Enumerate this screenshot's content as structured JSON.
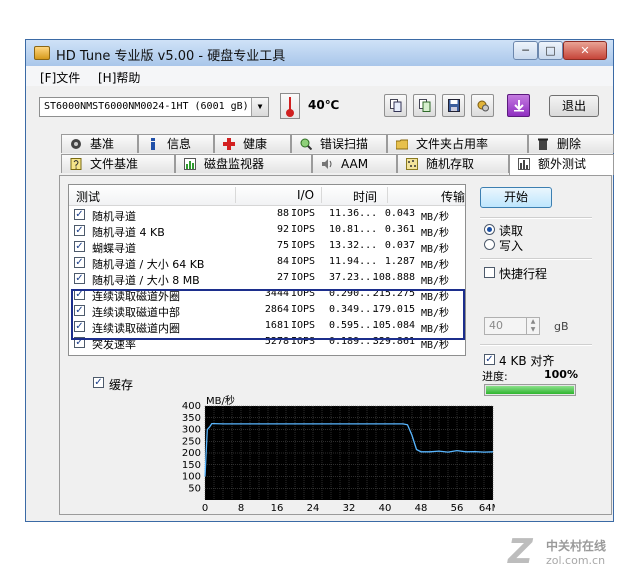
{
  "window": {
    "title": "HD Tune 专业版 v5.00 - 硬盘专业工具",
    "min": "─",
    "max": "□",
    "close": "✕"
  },
  "menu": [
    "[F]文件",
    "[H]帮助"
  ],
  "toolbar": {
    "drive": "ST6000NMST6000NM0024-1HT (6001 gB)",
    "temperature": "40℃",
    "exit_label": "退出",
    "buttons": [
      "copy-icon",
      "copy-all-icon",
      "save-icon",
      "options-icon",
      "download-icon"
    ]
  },
  "tabs_row1": [
    {
      "label": "基准",
      "icon": "benchmark-icon"
    },
    {
      "label": "信息",
      "icon": "info-icon"
    },
    {
      "label": "健康",
      "icon": "health-icon"
    },
    {
      "label": "错误扫描",
      "icon": "error-scan-icon"
    },
    {
      "label": "文件夹占用率",
      "icon": "folder-icon"
    },
    {
      "label": "删除",
      "icon": "erase-icon"
    }
  ],
  "tabs_row2": [
    {
      "label": "文件基准",
      "icon": "file-benchmark-icon"
    },
    {
      "label": "磁盘监视器",
      "icon": "disk-monitor-icon"
    },
    {
      "label": "AAM",
      "icon": "aam-icon"
    },
    {
      "label": "随机存取",
      "icon": "random-access-icon"
    },
    {
      "label": "额外测试",
      "icon": "extra-tests-icon"
    }
  ],
  "results": {
    "headers": {
      "test": "测试",
      "io": "I/O",
      "time": "时间",
      "rate": "传输"
    },
    "rows": [
      {
        "name": "随机寻道",
        "iops": "88",
        "iops_unit": "IOPS",
        "time": "11.36...",
        "rate": "0.043",
        "unit": "MB/秒"
      },
      {
        "name": "随机寻道 4 KB",
        "iops": "92",
        "iops_unit": "IOPS",
        "time": "10.81...",
        "rate": "0.361",
        "unit": "MB/秒"
      },
      {
        "name": "蝴蝶寻道",
        "iops": "75",
        "iops_unit": "IOPS",
        "time": "13.32...",
        "rate": "0.037",
        "unit": "MB/秒"
      },
      {
        "name": "随机寻道 / 大小 64 KB",
        "iops": "84",
        "iops_unit": "IOPS",
        "time": "11.94...",
        "rate": "1.287",
        "unit": "MB/秒"
      },
      {
        "name": "随机寻道 / 大小 8 MB",
        "iops": "27",
        "iops_unit": "IOPS",
        "time": "37.23...",
        "rate": "108.888",
        "unit": "MB/秒"
      },
      {
        "name": "连续读取磁道外圈",
        "iops": "3444",
        "iops_unit": "IOPS",
        "time": "0.290...",
        "rate": "215.275",
        "unit": "MB/秒"
      },
      {
        "name": "连续读取磁道中部",
        "iops": "2864",
        "iops_unit": "IOPS",
        "time": "0.349...",
        "rate": "179.015",
        "unit": "MB/秒"
      },
      {
        "name": "连续读取磁道内圈",
        "iops": "1681",
        "iops_unit": "IOPS",
        "time": "0.595...",
        "rate": "105.084",
        "unit": "MB/秒"
      },
      {
        "name": "突发速率",
        "iops": "5278",
        "iops_unit": "IOPS",
        "time": "0.189...",
        "rate": "329.861",
        "unit": "MB/秒"
      }
    ],
    "check_mark": "✓"
  },
  "cache_label": "缓存",
  "side": {
    "start_label": "开始",
    "read_label": "读取",
    "write_label": "写入",
    "short_stroke_label": "快捷行程",
    "short_stroke_value": "40",
    "short_stroke_unit": "gB",
    "align_label": "4 KB 对齐",
    "progress_label": "进度:",
    "progress_value": "100%",
    "progress_fraction": 1.0
  },
  "chart_data": {
    "type": "line",
    "ylabel": "MB/秒",
    "ylim": [
      0,
      400
    ],
    "yticks": [
      50,
      100,
      150,
      200,
      250,
      300,
      350,
      400
    ],
    "xlim": [
      0,
      64
    ],
    "xticks": [
      "0",
      "8",
      "16",
      "24",
      "32",
      "40",
      "48",
      "56",
      "64MB"
    ],
    "x": [
      0,
      0.5,
      1,
      1.5,
      2,
      4,
      8,
      12,
      16,
      20,
      24,
      28,
      32,
      36,
      40,
      44,
      45,
      46,
      47,
      48,
      49,
      50,
      52,
      54,
      56,
      58,
      60,
      62,
      64
    ],
    "y": [
      100,
      300,
      310,
      325,
      325,
      324,
      324,
      324,
      324,
      324,
      324,
      324,
      324,
      324,
      324,
      324,
      320,
      275,
      215,
      205,
      205,
      205,
      208,
      204,
      210,
      205,
      206,
      204,
      205
    ],
    "colors": {
      "background": "#000000",
      "grid": "#5a5a5a",
      "line": "#58b6ff"
    }
  },
  "watermark": {
    "name": "中关村在线",
    "url": "zol.com.cn",
    "logo": "Z"
  }
}
